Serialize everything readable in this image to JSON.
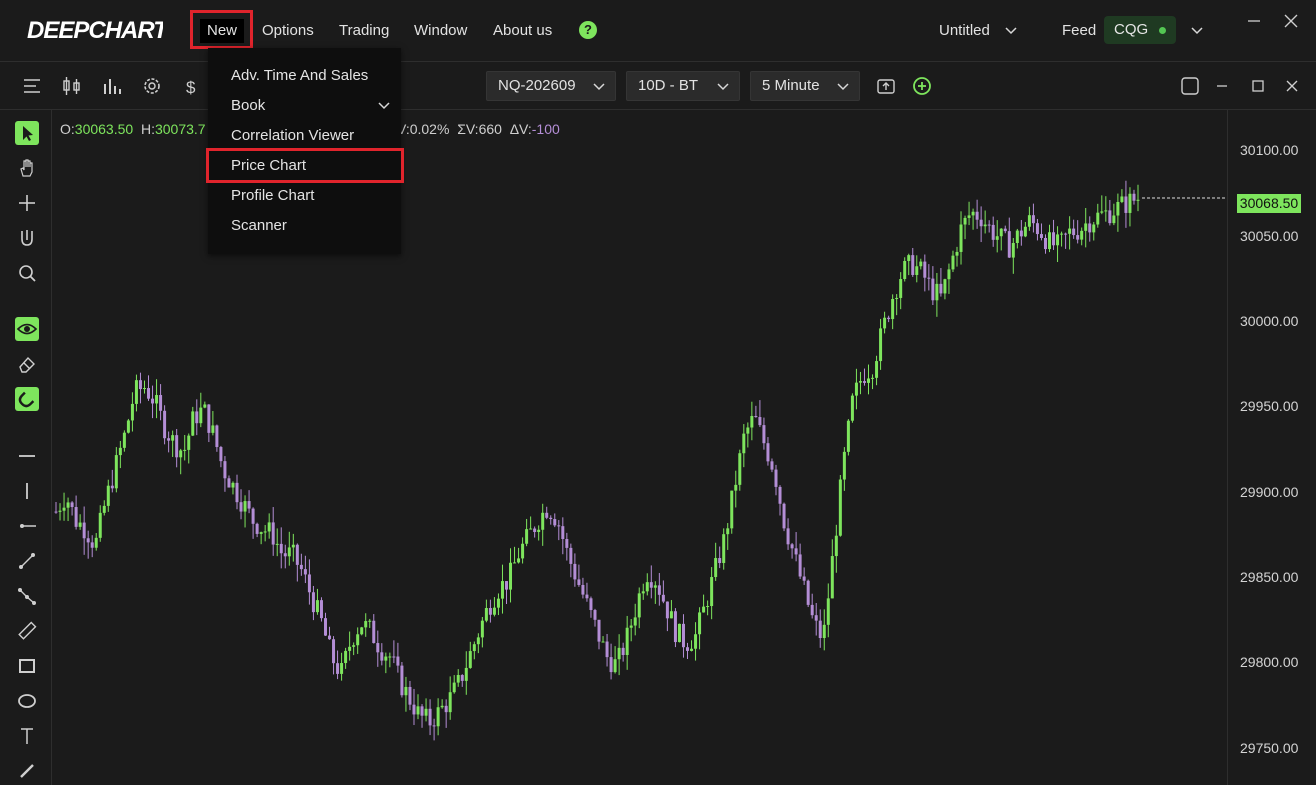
{
  "app": {
    "logo_text": "DEEPCHART"
  },
  "menubar": {
    "items": [
      "New",
      "Options",
      "Trading",
      "Window",
      "About us"
    ],
    "help_icon": "question-circle-icon"
  },
  "workspace": {
    "name": "Untitled"
  },
  "feed": {
    "label": "Feed",
    "name": "CQG",
    "status_color": "#53c653"
  },
  "toolbar": {
    "symbol": "NQ-202609",
    "range": "10D - BT",
    "interval": "5 Minute"
  },
  "ohlc": {
    "open_label": "O:",
    "open": "30063.50",
    "high_label": "H:",
    "high": "30073.7",
    "change_tail": "V:0.02%",
    "sum_vol_label": "ΣV:",
    "sum_vol": "660",
    "delta_vol_label": "ΔV:",
    "delta_vol": "-100"
  },
  "new_menu": {
    "items": [
      {
        "label": "Adv. Time And Sales",
        "submenu": false
      },
      {
        "label": "Book",
        "submenu": true
      },
      {
        "label": "Correlation Viewer",
        "submenu": false
      },
      {
        "label": "Price Chart",
        "submenu": false,
        "highlighted": true
      },
      {
        "label": "Profile Chart",
        "submenu": false
      },
      {
        "label": "Scanner",
        "submenu": false
      }
    ]
  },
  "price_axis": {
    "ticks": [
      "30100.00",
      "30050.00",
      "30000.00",
      "29950.00",
      "29900.00",
      "29850.00",
      "29800.00",
      "29750.00"
    ],
    "last_price": "30068.50"
  },
  "colors": {
    "up": "#7ee55d",
    "down": "#b48ed6",
    "highlight": "#e0242c",
    "accent": "#7ee55d"
  },
  "chart_data": {
    "type": "candlestick",
    "title": "",
    "xlabel": "",
    "ylabel": "",
    "ylim": [
      29725,
      30120
    ],
    "close_path": [
      29885,
      29895,
      29880,
      29875,
      29865,
      29890,
      29910,
      29930,
      29955,
      29958,
      29950,
      29935,
      29925,
      29920,
      29940,
      29945,
      29930,
      29910,
      29900,
      29890,
      29880,
      29875,
      29872,
      29860,
      29860,
      29850,
      29835,
      29820,
      29800,
      29790,
      29810,
      29820,
      29815,
      29805,
      29800,
      29785,
      29775,
      29765,
      29762,
      29768,
      29775,
      29785,
      29800,
      29815,
      29830,
      29840,
      29845,
      29860,
      29870,
      29880,
      29888,
      29880,
      29860,
      29845,
      29830,
      29815,
      29800,
      29795,
      29810,
      29830,
      29850,
      29845,
      29830,
      29815,
      29808,
      29812,
      29830,
      29850,
      29870,
      29900,
      29930,
      29940,
      29925,
      29910,
      29880,
      29860,
      29840,
      29820,
      29810,
      29860,
      29910,
      29950,
      29965,
      29970,
      29990,
      30010,
      30025,
      30030,
      30025,
      30015,
      30010,
      30030,
      30050,
      30060,
      30058,
      30050,
      30045,
      30040,
      30048,
      30055,
      30050,
      30042,
      30040,
      30048,
      30050,
      30055,
      30058,
      30060,
      30063,
      30066,
      30068.5
    ]
  }
}
